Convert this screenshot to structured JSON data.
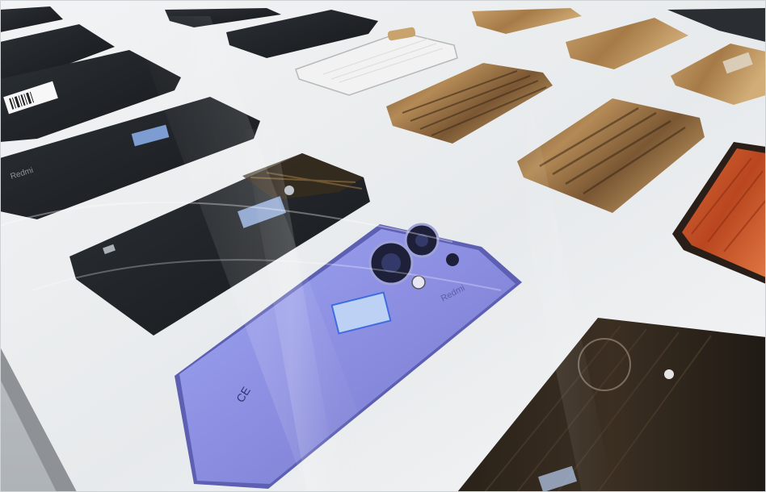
{
  "photo": {
    "subject": "smartphones-on-display-table",
    "palette": {
      "table": "#eef0f1",
      "floor": "#b9bdc1",
      "phone_black": "#1f2328",
      "phone_wood_light": "#b98f58",
      "phone_wood_dark": "#5e4327",
      "phone_orange": "#c9572c",
      "phone_white": "#f3f3f3",
      "phone_purple": "#8e8fe0",
      "label_blue": "#7fa7e6"
    }
  },
  "labels": {
    "brand_black_left": "Redmi",
    "brand_purple": "Redmi"
  }
}
